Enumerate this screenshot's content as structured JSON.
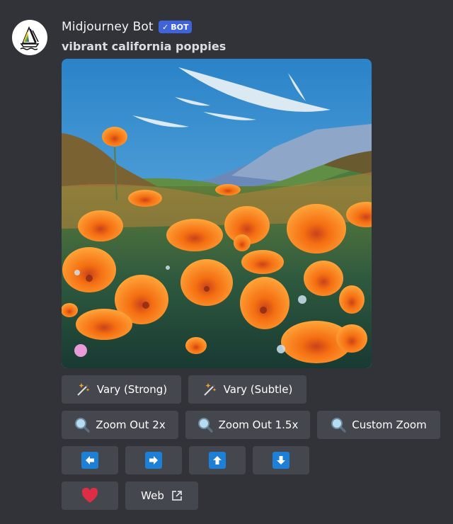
{
  "message": {
    "author": "Midjourney Bot",
    "badge": "BOT",
    "badge_check": "✓",
    "prompt": "vibrant california poppies",
    "avatar_icon": "sailboat-logo-icon",
    "image_alt": "Painting of orange California poppies in a meadow with blue mountains and sky"
  },
  "buttons": {
    "row1": [
      {
        "label": "Vary (Strong)",
        "icon": "magic-wand-icon"
      },
      {
        "label": "Vary (Subtle)",
        "icon": "magic-wand-icon"
      }
    ],
    "row2": [
      {
        "label": "Zoom Out 2x",
        "icon": "magnifier-icon"
      },
      {
        "label": "Zoom Out 1.5x",
        "icon": "magnifier-icon"
      },
      {
        "label": "Custom Zoom",
        "icon": "magnifier-icon"
      }
    ],
    "row3": [
      {
        "icon": "arrow-left-icon"
      },
      {
        "icon": "arrow-right-icon"
      },
      {
        "icon": "arrow-up-icon"
      },
      {
        "icon": "arrow-down-icon"
      }
    ],
    "row4": [
      {
        "icon": "heart-icon"
      },
      {
        "label": "Web",
        "icon": "external-link-icon"
      }
    ]
  },
  "colors": {
    "background": "#313338",
    "button": "#45474e",
    "badge": "#3f63d8",
    "arrow": "#1d7fd6",
    "heart": "#dd2e44"
  }
}
